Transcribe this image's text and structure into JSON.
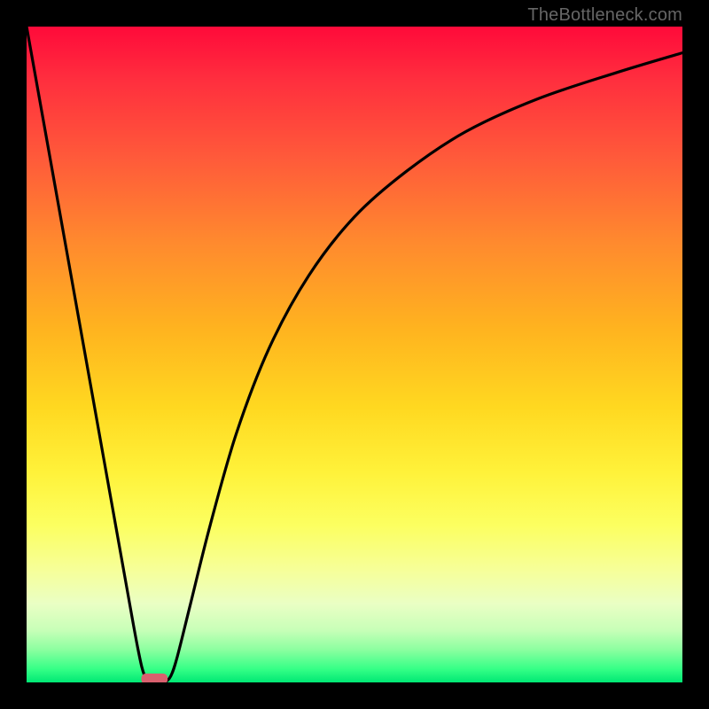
{
  "watermark": "TheBottleneck.com",
  "chart_data": {
    "type": "line",
    "title": "",
    "xlabel": "",
    "ylabel": "",
    "xlim": [
      0,
      100
    ],
    "ylim": [
      0,
      100
    ],
    "series": [
      {
        "name": "bottleneck-curve",
        "x": [
          0,
          5,
          10,
          15,
          17,
          18,
          19,
          20,
          21,
          22,
          23,
          25,
          28,
          32,
          37,
          43,
          50,
          58,
          67,
          78,
          90,
          100
        ],
        "values": [
          100,
          72,
          44,
          16,
          5,
          1,
          0,
          0,
          0,
          1,
          4,
          12,
          24,
          38,
          51,
          62,
          71,
          78,
          84,
          89,
          93,
          96
        ]
      }
    ],
    "marker": {
      "name": "optimal-marker",
      "x_center": 19.5,
      "y": 0,
      "width": 4,
      "color": "#d9606e"
    },
    "background_gradient": {
      "type": "vertical",
      "stops": [
        {
          "pos": 0.0,
          "color": "#ff0a3a"
        },
        {
          "pos": 0.33,
          "color": "#ff8a2e"
        },
        {
          "pos": 0.66,
          "color": "#fff23a"
        },
        {
          "pos": 0.9,
          "color": "#d8ffb8"
        },
        {
          "pos": 1.0,
          "color": "#00e874"
        }
      ]
    }
  }
}
